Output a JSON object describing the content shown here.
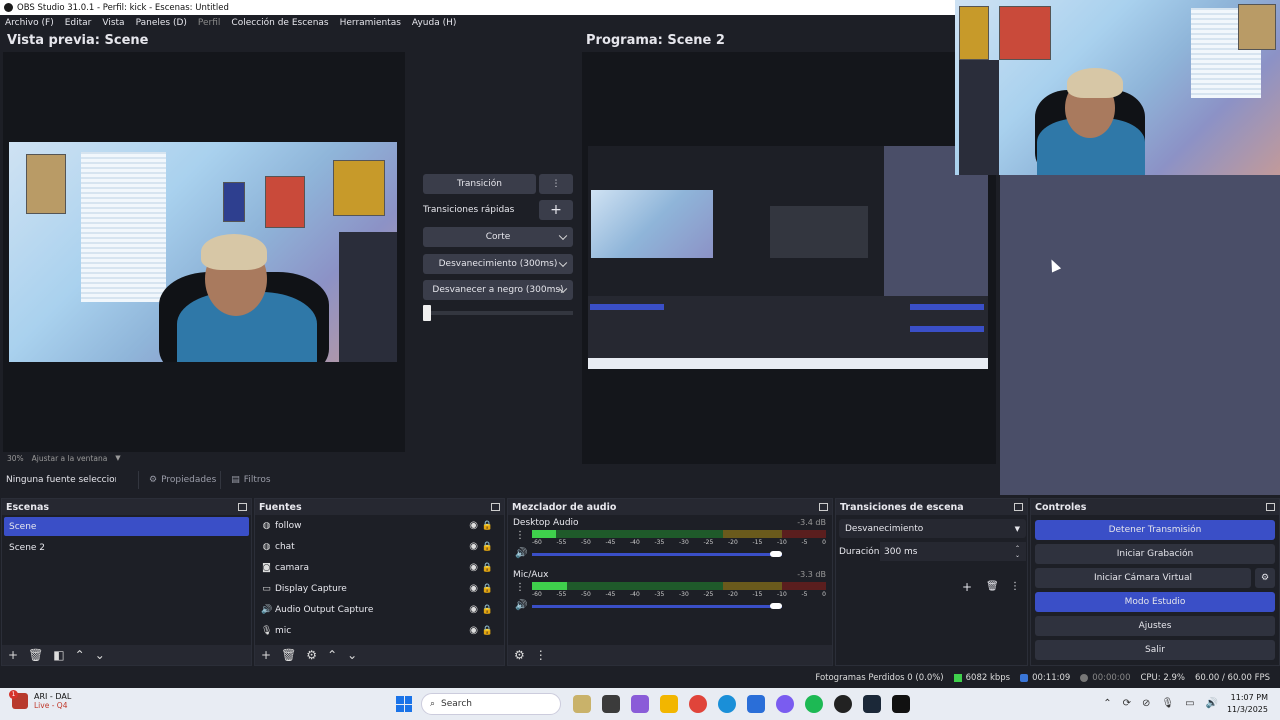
{
  "window": {
    "title": "OBS Studio 31.0.1 - Perfil: kick - Escenas: Untitled"
  },
  "menu": [
    "Archivo (F)",
    "Editar",
    "Vista",
    "Paneles (D)",
    "Perfil",
    "Colección de Escenas",
    "Herramientas",
    "Ayuda (H)"
  ],
  "preview": {
    "title": "Vista previa: Scene",
    "zoom": "30%",
    "fit": "Ajustar a la ventana"
  },
  "program": {
    "title": "Programa: Scene 2"
  },
  "transition_panel": {
    "transition_button": "Transición",
    "quick_transitions": "Transiciones rápidas",
    "options": [
      "Corte",
      "Desvanecimiento (300ms)",
      "Desvanecer a negro (300ms)"
    ],
    "tbar_value": 0
  },
  "props_row": {
    "no_source": "Ninguna fuente seleccionada",
    "properties": "Propiedades",
    "filters": "Filtros"
  },
  "scenes": {
    "title": "Escenas",
    "items": [
      "Scene",
      "Scene 2"
    ],
    "selected": "Scene"
  },
  "sources": {
    "title": "Fuentes",
    "items": [
      {
        "name": "follow",
        "icon": "globe-icon"
      },
      {
        "name": "chat",
        "icon": "globe-icon"
      },
      {
        "name": "camara",
        "icon": "camera-icon"
      },
      {
        "name": "Display Capture",
        "icon": "monitor-icon"
      },
      {
        "name": "Audio Output Capture",
        "icon": "speaker-icon"
      },
      {
        "name": "mic",
        "icon": "microphone-icon"
      }
    ]
  },
  "mixer": {
    "title": "Mezclador de audio",
    "channels": [
      {
        "name": "Desktop Audio",
        "db": "-3.4 dB",
        "level": 0.08,
        "volume": 1.0
      },
      {
        "name": "Mic/Aux",
        "db": "-3.3 dB",
        "level": 0.12,
        "volume": 1.0
      }
    ],
    "scale": [
      "-60",
      "-55",
      "-50",
      "-45",
      "-40",
      "-35",
      "-30",
      "-25",
      "-20",
      "-15",
      "-10",
      "-5",
      "0"
    ]
  },
  "scene_transitions": {
    "title": "Transiciones de escena",
    "selected": "Desvanecimiento",
    "duration_label": "Duración",
    "duration_value": "300 ms"
  },
  "controls": {
    "title": "Controles",
    "buttons": [
      "Detener Transmisión",
      "Iniciar Grabación",
      "Iniciar Cámara Virtual",
      "Modo Estudio",
      "Ajustes",
      "Salir"
    ]
  },
  "status": {
    "dropped": "Fotogramas Perdidos 0 (0.0%)",
    "bitrate": "6082 kbps",
    "stream_time": "00:11:09",
    "rec_time": "00:00:00",
    "cpu": "CPU: 2.9%",
    "fps": "60.00 / 60.00 FPS"
  },
  "taskbar": {
    "weather_title": "ARI - DAL",
    "weather_sub": "Live - Q4",
    "badge": "1",
    "search": "Search",
    "time": "11:07 PM",
    "date": "11/3/2025"
  }
}
